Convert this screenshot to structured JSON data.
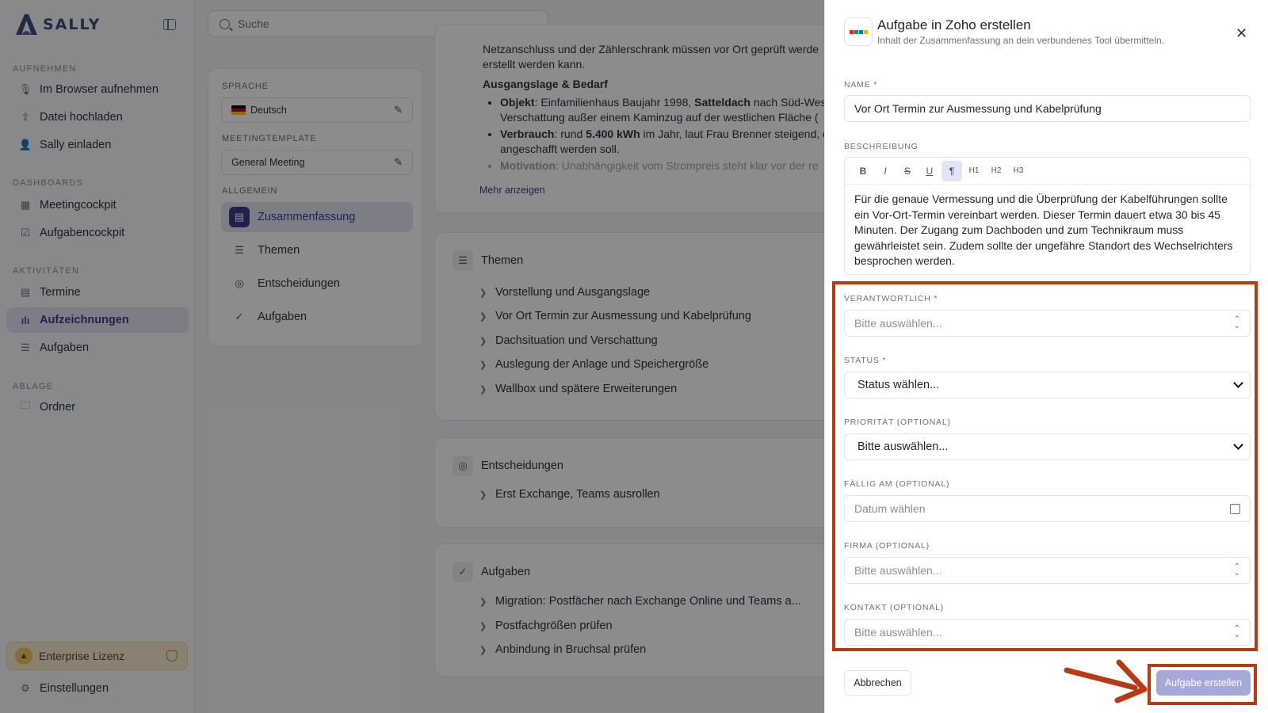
{
  "app": {
    "logo_text": "SALLY",
    "search_placeholder": "Suche"
  },
  "sidebar": {
    "sections": [
      {
        "title": "AUFNEHMEN",
        "items": [
          {
            "label": "Im Browser aufnehmen",
            "icon": "mic-icon"
          },
          {
            "label": "Datei hochladen",
            "icon": "upload-icon"
          },
          {
            "label": "Sally einladen",
            "icon": "user-plus-icon"
          }
        ]
      },
      {
        "title": "DASHBOARDS",
        "items": [
          {
            "label": "Meetingcockpit",
            "icon": "grid-icon"
          },
          {
            "label": "Aufgabencockpit",
            "icon": "checkbox-icon"
          }
        ]
      },
      {
        "title": "AKTIVITÄTEN",
        "items": [
          {
            "label": "Termine",
            "icon": "calendar-icon"
          },
          {
            "label": "Aufzeichnungen",
            "icon": "waveform-icon",
            "active": true
          },
          {
            "label": "Aufgaben",
            "icon": "tasklist-icon"
          }
        ]
      },
      {
        "title": "ABLAGE",
        "items": [
          {
            "label": "Ordner",
            "icon": "folder-icon"
          }
        ]
      }
    ],
    "license": "Enterprise Lizenz",
    "settings": "Einstellungen"
  },
  "meeting_settings": {
    "language_label": "SPRACHE",
    "language_value": "Deutsch",
    "template_label": "MEETINGTEMPLATE",
    "template_value": "General Meeting",
    "general_label": "ALLGEMEIN",
    "tabs": [
      "Zusammenfassung",
      "Themen",
      "Entscheidungen",
      "Aufgaben"
    ]
  },
  "summary": {
    "intro_fragment": "Netzanschluss und der Zählerschrank müssen vor Ort geprüft werde",
    "intro_line2": "erstellt werden kann.",
    "heading": "Ausgangslage & Bedarf",
    "bullets": [
      {
        "bold": "Objekt",
        "text": ": Einfamilienhaus Baujahr 1998, ",
        "bold2": "Satteldach",
        "text2": " nach Süd-Wes",
        "line2": "Verschattung außer einem Kaminzug auf der westlichen Fläche ("
      },
      {
        "bold": "Verbrauch",
        "text": ": rund ",
        "bold2": "5.400 kWh",
        "text2": " im Jahr, laut Frau Brenner steigend, d",
        "line2": "angeschafft werden soll."
      },
      {
        "bold": "Motivation",
        "text": ": Unabhängigkeit vom Strompreis steht klar vor der re",
        "bold2": "",
        "text2": "",
        "line2": ""
      }
    ],
    "more_link": "Mehr anzeigen"
  },
  "themen": {
    "title": "Themen",
    "items": [
      "Vorstellung und Ausgangslage",
      "Vor Ort Termin zur Ausmessung und Kabelprüfung",
      "Dachsituation und Verschattung",
      "Auslegung der Anlage und Speichergröße",
      "Wallbox und spätere Erweiterungen"
    ]
  },
  "entscheidungen": {
    "title": "Entscheidungen",
    "items": [
      "Erst Exchange, Teams ausrollen"
    ]
  },
  "aufgaben": {
    "title": "Aufgaben",
    "items": [
      "Migration: Postfächer nach Exchange Online und Teams a...",
      "Postfachgrößen prüfen",
      "Anbindung in Bruchsal prüfen"
    ]
  },
  "panel": {
    "title": "Aufgabe in Zoho erstellen",
    "subtitle": "Inhalt der Zusammenfassung an dein verbundenes Tool übermitteln.",
    "name_label": "NAME *",
    "name_value": "Vor Ort Termin zur Ausmessung und Kabelprüfung",
    "description_label": "BESCHREIBUNG",
    "toolbar": [
      "B",
      "I",
      "S",
      "U",
      "¶",
      "H1",
      "H2",
      "H3"
    ],
    "description_value": "Für die genaue Vermessung und die Überprüfung der Kabelführungen sollte ein Vor-Ort-Termin vereinbart werden. Dieser Termin dauert etwa 30 bis 45 Minuten. Der Zugang zum Dachboden und zum Technikraum muss gewährleistet sein. Zudem sollte der ungefähre Standort des Wechselrichters besprochen werden.",
    "responsible_label": "VERANTWORTLICH *",
    "responsible_placeholder": "Bitte auswählen...",
    "status_label": "STATUS *",
    "status_value": "Status wählen...",
    "priority_label": "PRIORITÄT (OPTIONAL)",
    "priority_value": "Bitte auswählen...",
    "due_label": "FÄLLIG AM (OPTIONAL)",
    "due_placeholder": "Datum wählen",
    "company_label": "FIRMA (OPTIONAL)",
    "company_placeholder": "Bitte auswählen...",
    "contact_label": "KONTAKT (OPTIONAL)",
    "contact_placeholder": "Bitte auswählen...",
    "cancel_label": "Abbrechen",
    "submit_label": "Aufgabe erstellen"
  },
  "colors": {
    "accent": "#3b3f8c",
    "annotation": "#b83a14",
    "submit_disabled": "#a6a8d8"
  }
}
